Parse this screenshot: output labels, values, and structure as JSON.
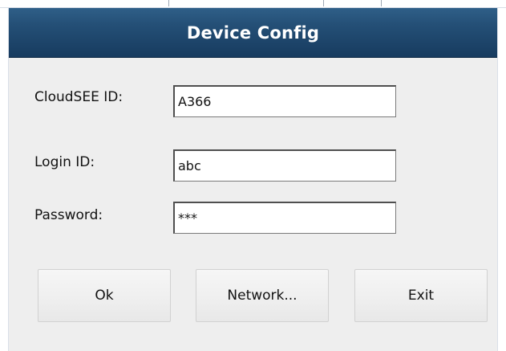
{
  "dialog": {
    "title": "Device Config",
    "fields": [
      {
        "label": "CloudSEE ID:",
        "value": "A366"
      },
      {
        "label": "Login ID:",
        "value": "abc"
      },
      {
        "label": "Password:",
        "value": "***"
      }
    ],
    "buttons": {
      "ok": "Ok",
      "network": "Network...",
      "exit": "Exit"
    },
    "colors": {
      "title_bar": "#244f76",
      "dialog_background": "#eeeeee",
      "button_background": "#f0f0f0",
      "input_border": "#4f4f4f"
    }
  }
}
